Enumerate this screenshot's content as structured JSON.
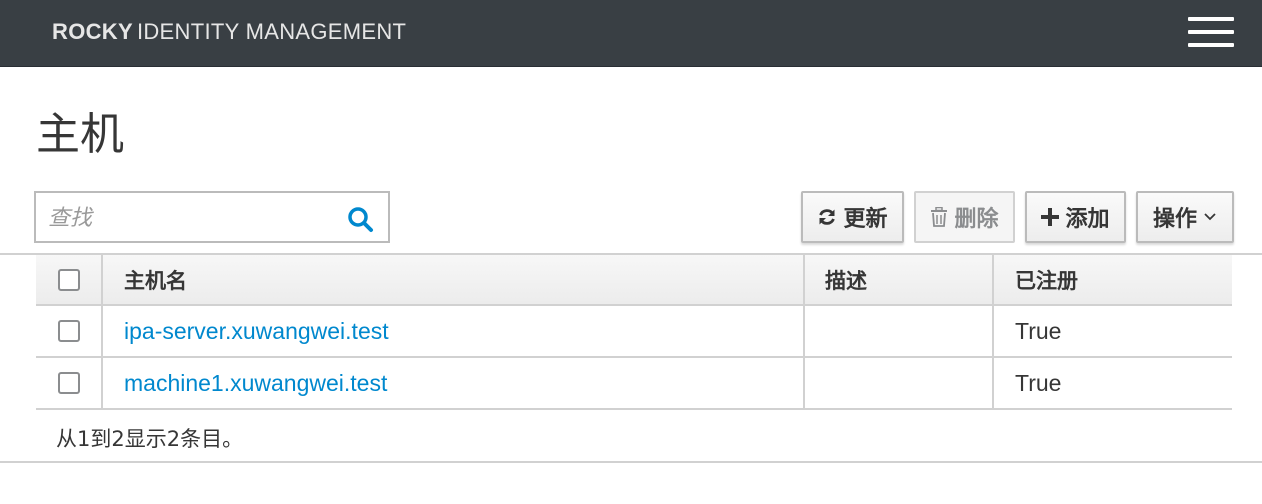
{
  "navbar": {
    "brand_bold": "ROCKY",
    "brand_rest": "IDENTITY MANAGEMENT"
  },
  "page": {
    "title": "主机"
  },
  "search": {
    "placeholder": "查找"
  },
  "toolbar": {
    "refresh_label": "更新",
    "delete_label": "删除",
    "add_label": "添加",
    "actions_label": "操作"
  },
  "table": {
    "columns": [
      "主机名",
      "描述",
      "已注册"
    ],
    "rows": [
      {
        "hostname": "ipa-server.xuwangwei.test",
        "description": "",
        "registered": "True"
      },
      {
        "hostname": "machine1.xuwangwei.test",
        "description": "",
        "registered": "True"
      }
    ]
  },
  "footer": {
    "summary": "从1到2显示2条目。"
  },
  "colors": {
    "navbar_bg": "#393f44",
    "link": "#0088ce",
    "border": "#d1d1d1"
  },
  "icons": {
    "menu": "hamburger-icon",
    "search": "search-icon",
    "refresh": "refresh-icon",
    "delete": "trash-icon",
    "add": "plus-icon",
    "actions": "chevron-down-icon"
  }
}
